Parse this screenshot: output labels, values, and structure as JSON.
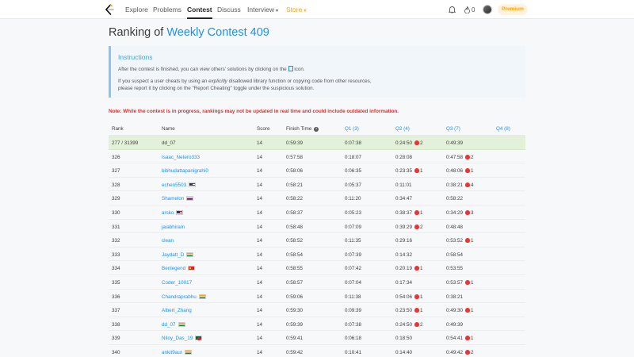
{
  "nav": {
    "items": [
      "Explore",
      "Problems",
      "Contest",
      "Discuss",
      "Interview",
      "Store"
    ],
    "fire_count": "0",
    "premium_label": "Premium"
  },
  "page": {
    "title_prefix": "Ranking of ",
    "title_contest": "Weekly Contest 409"
  },
  "instructions": {
    "title": "Instructions",
    "line1_a": "After the contest is finished, you can view others' solutions by clicking on the",
    "line1_b": "icon.",
    "line2_a": "If you suspect a user cheats by using an ",
    "line2_em": "explicitly",
    "line2_b": " disallowed library function or copying code from other resources,",
    "line3": "please report it by clicking on the \"Report Cheating\" toggle under the suspicious solution."
  },
  "note": "Note: While the contest is in progress, rankings may not be updated in real time and could include outdated information.",
  "table": {
    "headers": {
      "rank": "Rank",
      "name": "Name",
      "score": "Score",
      "finish": "Finish Time",
      "q1": "Q1 (3)",
      "q2": "Q2 (4)",
      "q3": "Q3 (7)",
      "q4": "Q4 (8)"
    },
    "rows": [
      {
        "rank": "277 / 31399",
        "name": "dd_07",
        "flag": "",
        "score": "14",
        "finish": "0:59:39",
        "q1": "0:07:38",
        "q1_bug": "",
        "q2": "0:24:50",
        "q2_bug": "2",
        "q3": "0:49:39",
        "q3_bug": "",
        "me": true
      },
      {
        "rank": "326",
        "name": "Isaac_Netero333",
        "flag": "",
        "score": "14",
        "finish": "0:57:58",
        "q1": "0:18:07",
        "q1_bug": "",
        "q2": "0:28:08",
        "q2_bug": "",
        "q3": "0:47:58",
        "q3_bug": "2"
      },
      {
        "rank": "327",
        "name": "bibhudattapanigrahi0",
        "flag": "",
        "score": "14",
        "finish": "0:58:06",
        "q1": "0:06:35",
        "q1_bug": "",
        "q2": "0:23:35",
        "q2_bug": "1",
        "q3": "0:48:06",
        "q3_bug": "1"
      },
      {
        "rank": "328",
        "name": "echen5503",
        "flag": "us",
        "score": "14",
        "finish": "0:58:21",
        "q1": "0:05:37",
        "q1_bug": "",
        "q2": "0:11:01",
        "q2_bug": "",
        "q3": "0:38:21",
        "q3_bug": "4"
      },
      {
        "rank": "329",
        "name": "Shamelon",
        "flag": "ru",
        "score": "14",
        "finish": "0:58:22",
        "q1": "0:11:20",
        "q1_bug": "",
        "q2": "0:34:47",
        "q2_bug": "",
        "q3": "0:58:22",
        "q3_bug": ""
      },
      {
        "rank": "330",
        "name": "arsko",
        "flag": "us",
        "score": "14",
        "finish": "0:58:37",
        "q1": "0:05:23",
        "q1_bug": "",
        "q2": "0:38:37",
        "q2_bug": "1",
        "q3": "0:34:29",
        "q3_bug": "3"
      },
      {
        "rank": "331",
        "name": "jaiabhiram",
        "flag": "",
        "score": "14",
        "finish": "0:58:48",
        "q1": "0:07:09",
        "q1_bug": "",
        "q2": "0:39:29",
        "q2_bug": "2",
        "q3": "0:48:48",
        "q3_bug": ""
      },
      {
        "rank": "332",
        "name": "clean",
        "flag": "",
        "score": "14",
        "finish": "0:58:52",
        "q1": "0:11:35",
        "q1_bug": "",
        "q2": "0:29:16",
        "q2_bug": "",
        "q3": "0:53:52",
        "q3_bug": "1"
      },
      {
        "rank": "333",
        "name": "Jaydatt_D",
        "flag": "in",
        "score": "14",
        "finish": "0:58:54",
        "q1": "0:07:39",
        "q1_bug": "",
        "q2": "0:14:32",
        "q2_bug": "",
        "q3": "0:58:54",
        "q3_bug": ""
      },
      {
        "rank": "334",
        "name": "Benlegend",
        "flag": "cn",
        "score": "14",
        "finish": "0:58:55",
        "q1": "0:07:42",
        "q1_bug": "",
        "q2": "0:20:19",
        "q2_bug": "1",
        "q3": "0:53:55",
        "q3_bug": ""
      },
      {
        "rank": "335",
        "name": "Coder_10017",
        "flag": "",
        "score": "14",
        "finish": "0:58:57",
        "q1": "0:07:04",
        "q1_bug": "",
        "q2": "0:17:34",
        "q2_bug": "",
        "q3": "0:53:57",
        "q3_bug": "1"
      },
      {
        "rank": "336",
        "name": "Chandraprabhu",
        "flag": "in",
        "score": "14",
        "finish": "0:59:06",
        "q1": "0:11:38",
        "q1_bug": "",
        "q2": "0:54:06",
        "q2_bug": "1",
        "q3": "0:38:21",
        "q3_bug": ""
      },
      {
        "rank": "337",
        "name": "Albert_Zhang",
        "flag": "",
        "score": "14",
        "finish": "0:59:30",
        "q1": "0:09:39",
        "q1_bug": "",
        "q2": "0:23:50",
        "q2_bug": "1",
        "q3": "0:49:30",
        "q3_bug": "1"
      },
      {
        "rank": "338",
        "name": "dd_07",
        "flag": "in",
        "score": "14",
        "finish": "0:59:39",
        "q1": "0:07:38",
        "q1_bug": "",
        "q2": "0:24:50",
        "q2_bug": "2",
        "q3": "0:49:39",
        "q3_bug": ""
      },
      {
        "rank": "339",
        "name": "Niloy_Das_19",
        "flag": "bd",
        "score": "14",
        "finish": "0:59:41",
        "q1": "0:06:18",
        "q1_bug": "",
        "q2": "0:18:50",
        "q2_bug": "",
        "q3": "0:54:41",
        "q3_bug": "1"
      },
      {
        "rank": "340",
        "name": "ankit9aur",
        "flag": "in",
        "score": "14",
        "finish": "0:59:42",
        "q1": "0:10:41",
        "q1_bug": "",
        "q2": "0:14:40",
        "q2_bug": "",
        "q3": "0:49:42",
        "q3_bug": "2"
      }
    ]
  },
  "colors": {
    "accent": "#1a90ff",
    "store": "#ffa116",
    "note_red": "#e02d2d",
    "highlight_row": "#e3f1da"
  }
}
